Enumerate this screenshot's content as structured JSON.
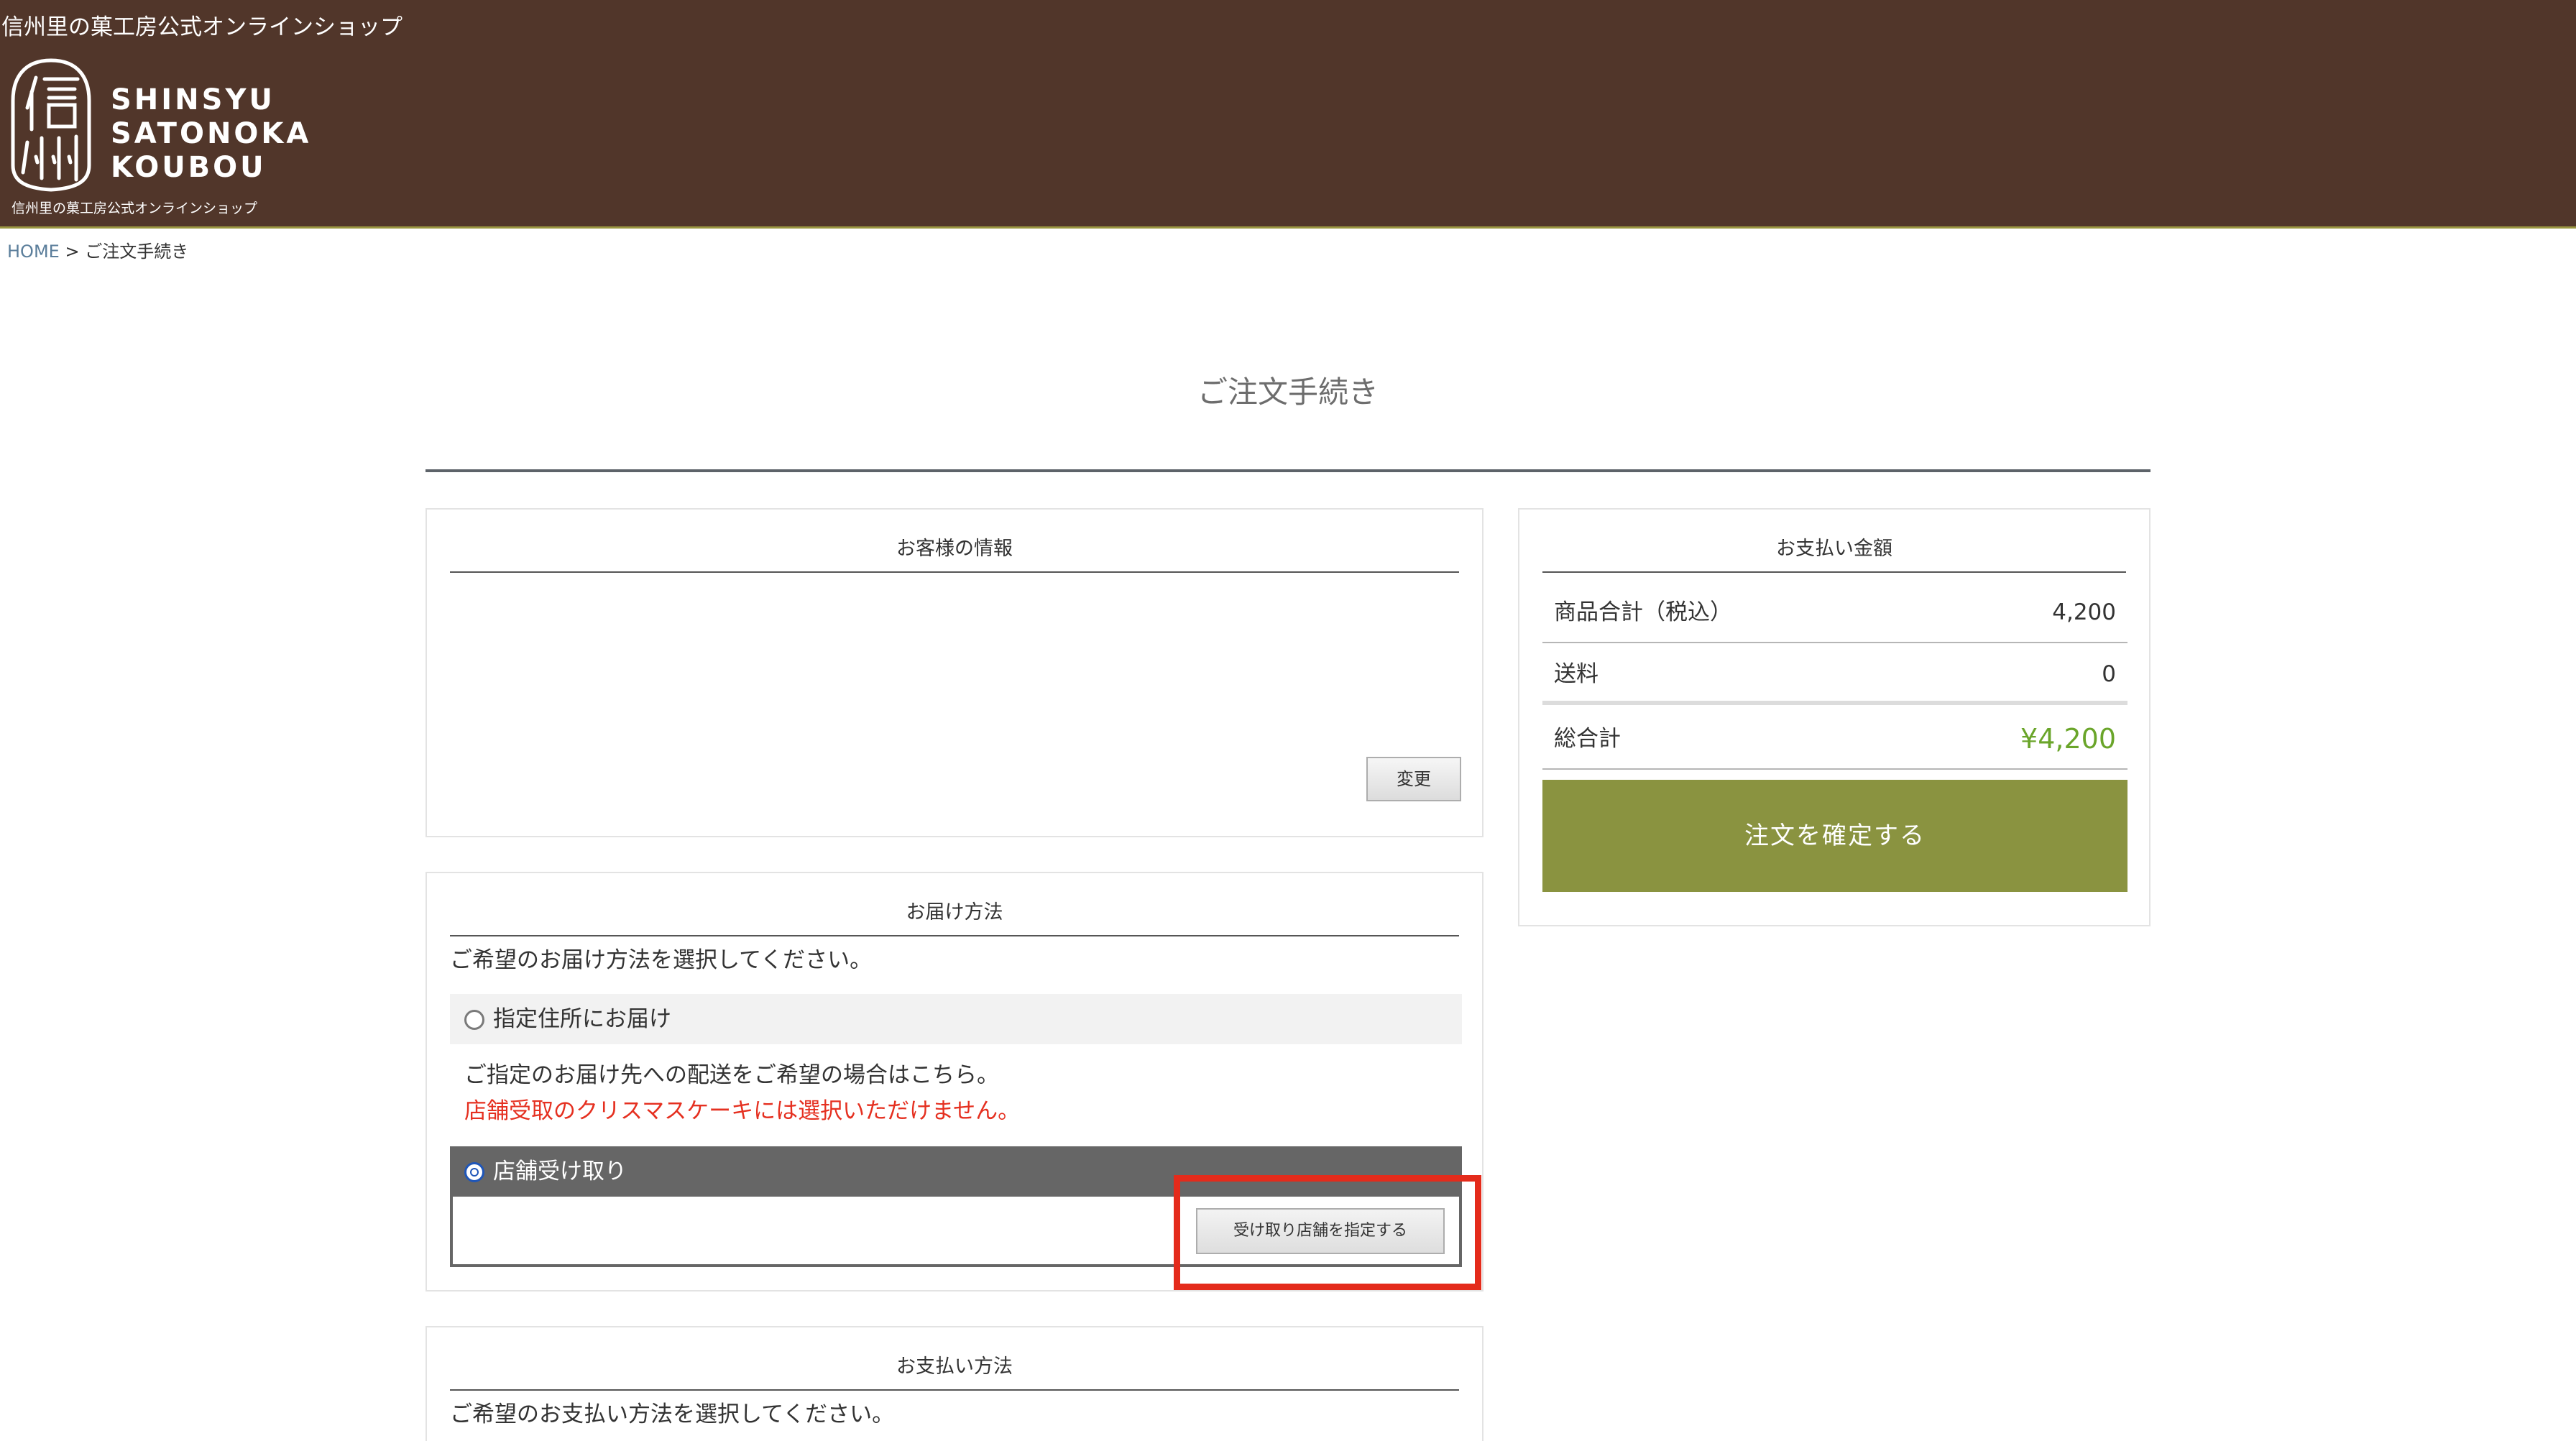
{
  "header": {
    "site_name": "信州里の菓工房公式オンラインショップ",
    "logo_kanji": "信州",
    "logo_words": [
      "SHINSYU",
      "SATONOKA",
      "KOUBOU"
    ],
    "logo_sub": "信州里の菓工房公式オンラインショップ",
    "colors": {
      "background": "#51362a",
      "accent_line": "#9a9641"
    }
  },
  "breadcrumb": {
    "home": "HOME",
    "separator": ">",
    "current": "ご注文手続き"
  },
  "page": {
    "title": "ご注文手続き"
  },
  "customer": {
    "heading": "お客様の情報",
    "change_button": "変更"
  },
  "delivery": {
    "heading": "お届け方法",
    "instruction": "ご希望のお届け方法を選択してください。",
    "options": [
      {
        "label": "指定住所にお届け",
        "selected": false,
        "description": "ご指定のお届け先への配送をご希望の場合はこちら。",
        "notice": "店舗受取のクリスマスケーキには選択いただけません。"
      },
      {
        "label": "店舗受け取り",
        "selected": true,
        "button": "受け取り店舗を指定する"
      }
    ]
  },
  "payment_method": {
    "heading": "お支払い方法",
    "instruction": "ご希望のお支払い方法を選択してください。"
  },
  "summary": {
    "heading": "お支払い金額",
    "rows": [
      {
        "label": "商品合計（税込）",
        "value": "4,200"
      },
      {
        "label": "送料",
        "value": "0"
      },
      {
        "label": "総合計",
        "value": "¥4,200"
      }
    ],
    "confirm_button": "注文を確定する",
    "colors": {
      "total": "#6aa52a",
      "confirm": "#8a9340",
      "highlight": "#e42b1b"
    }
  }
}
